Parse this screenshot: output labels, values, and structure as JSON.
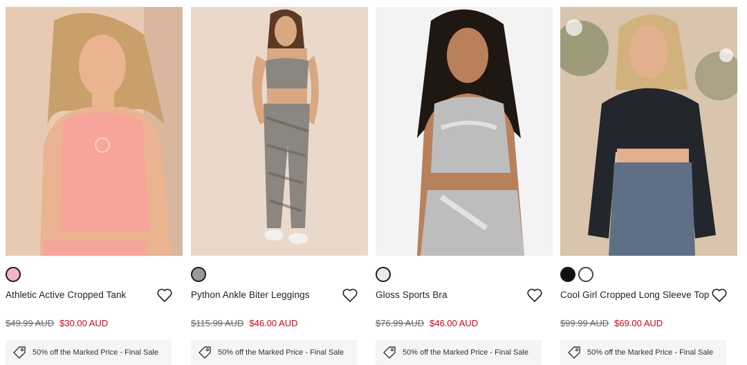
{
  "products": [
    {
      "name": "Athletic Active Cropped Tank",
      "was_price": "$49.99 AUD",
      "now_price": "$30.00 AUD",
      "promo": "50% off the Marked Price - Final Sale",
      "swatches": [
        "#f7b4c4"
      ],
      "photo": {
        "bg": "#e8c9b2",
        "top": "#f7a59a",
        "bottom": "#f7a59a",
        "hair": "#c9a06b",
        "skin": "#e9b48f"
      }
    },
    {
      "name": "Python Ankle Biter Leggings",
      "was_price": "$115.99 AUD",
      "now_price": "$46.00 AUD",
      "promo": "50% off the Marked Price - Final Sale",
      "swatches": [
        "#9a9a9a"
      ],
      "photo": {
        "bg": "#e7d5c7",
        "top": "#8b8680",
        "bottom": "#8b8680",
        "hair": "#5b3a24",
        "skin": "#d9a882"
      }
    },
    {
      "name": "Gloss Sports Bra",
      "was_price": "$76.99 AUD",
      "now_price": "$46.00 AUD",
      "promo": "50% off the Marked Price - Final Sale",
      "swatches": [
        "#e6ebf0"
      ],
      "photo": {
        "bg": "#f3f3f3",
        "top": "#bdbdbd",
        "bottom": "#bdbdbd",
        "hair": "#1f1712",
        "skin": "#b9805c"
      }
    },
    {
      "name": "Cool Girl Cropped Long Sleeve Top",
      "was_price": "$99.99 AUD",
      "now_price": "$69.00 AUD",
      "promo": "50% off the Marked Price - Final Sale",
      "swatches": [
        "#111111",
        "#ffffff"
      ],
      "photo": {
        "bg": "#d9c4ad",
        "top": "#23262d",
        "bottom": "#5f6f85",
        "hair": "#d2b27c",
        "skin": "#e3b08d"
      }
    }
  ]
}
